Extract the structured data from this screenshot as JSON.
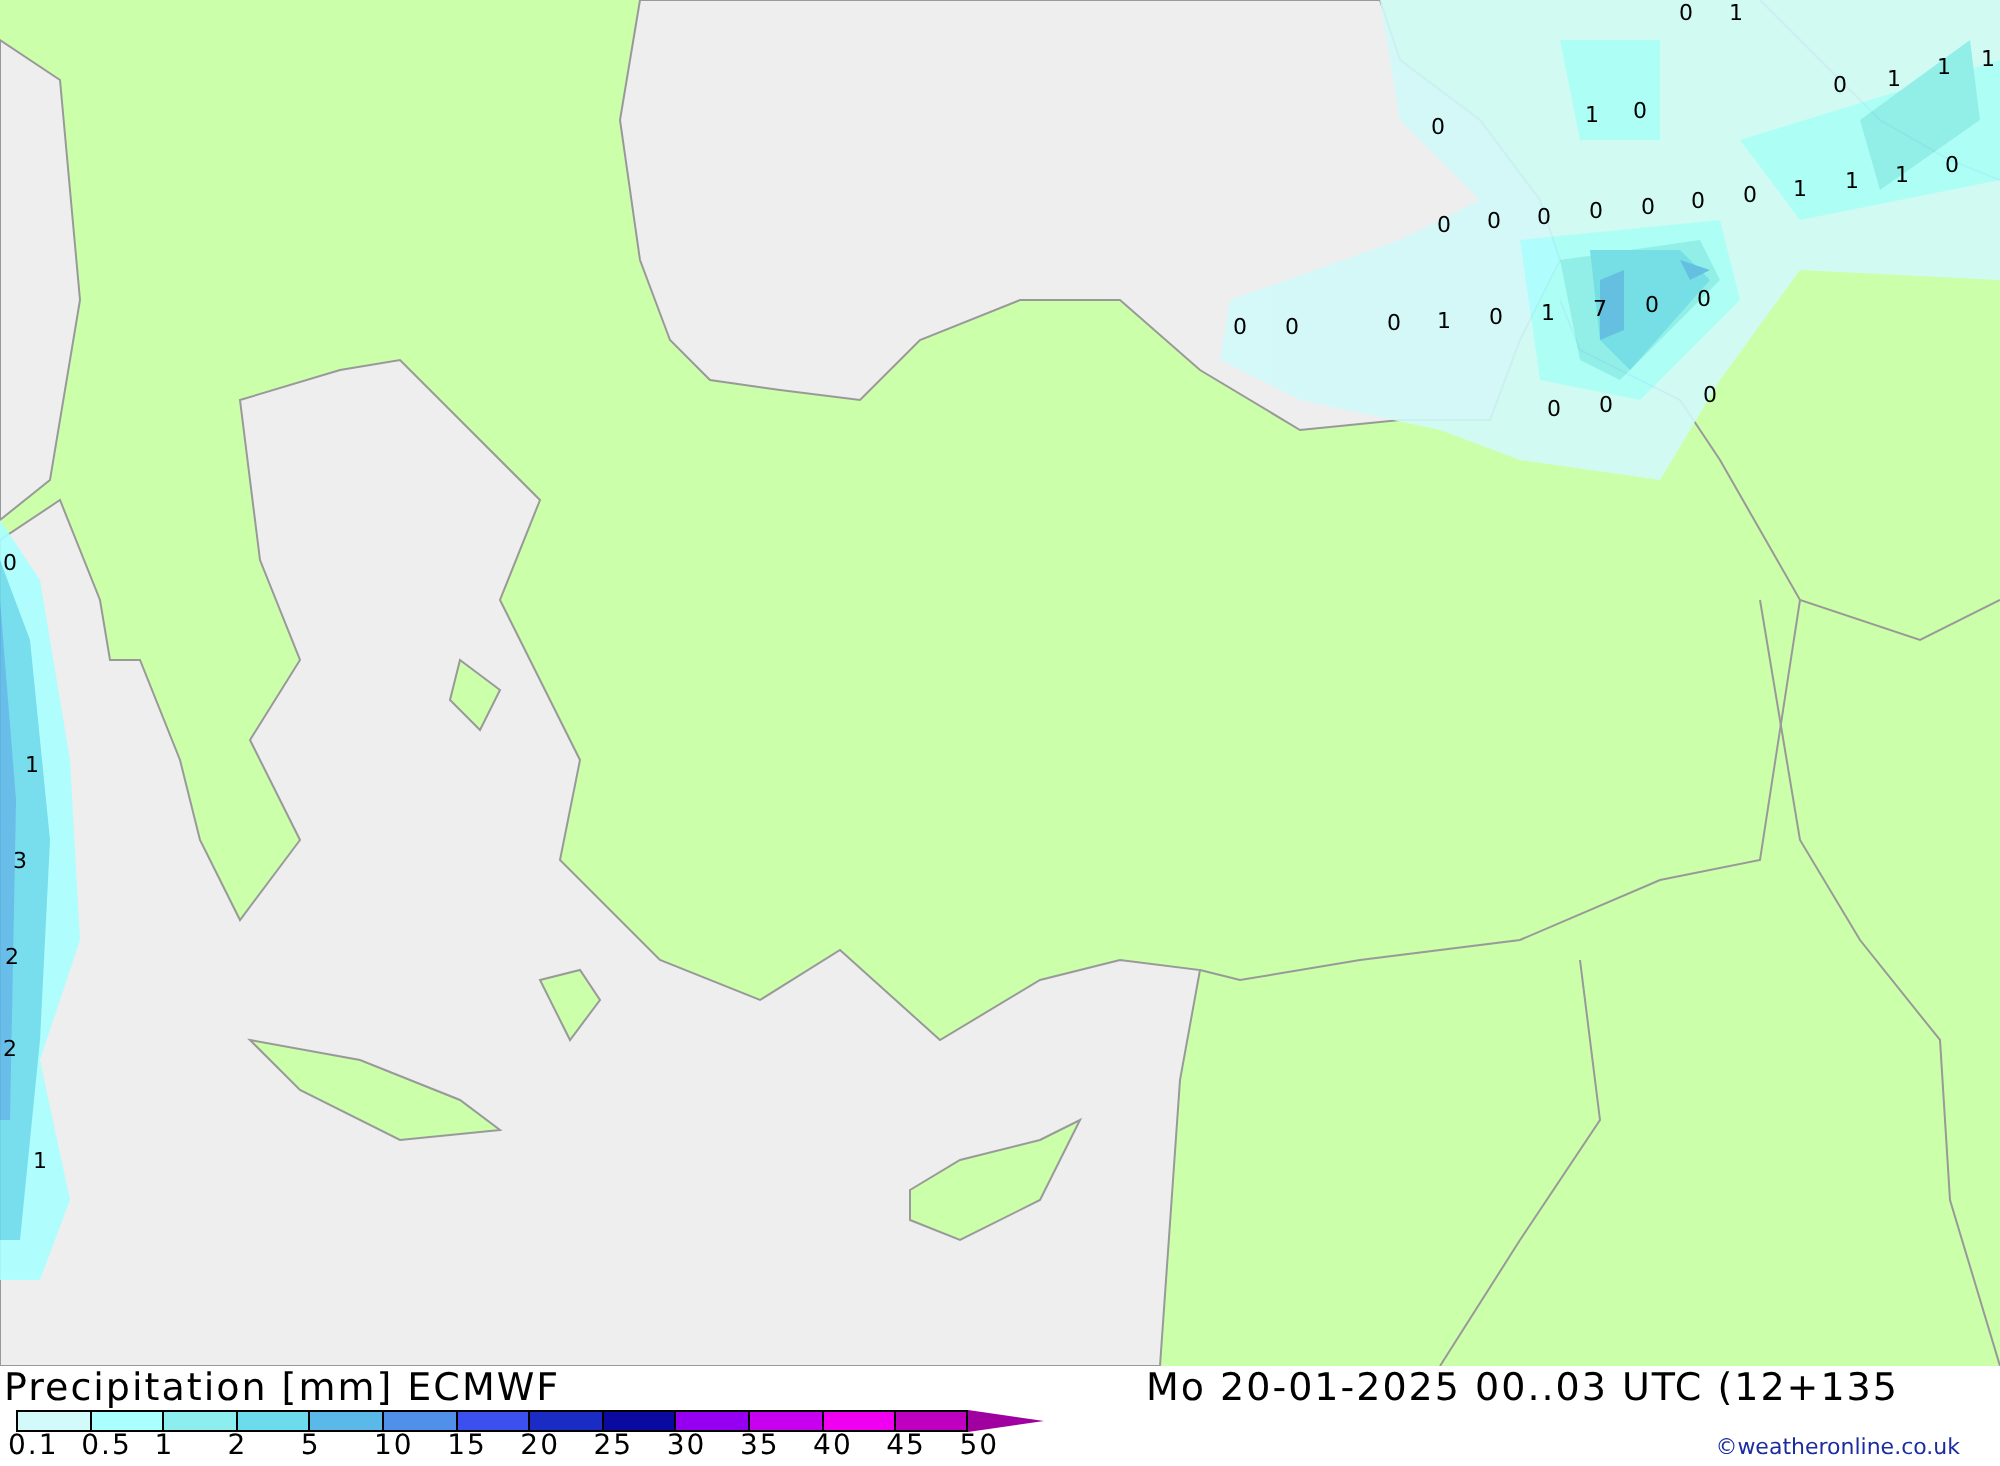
{
  "map": {
    "values": [
      "0",
      "1",
      "0",
      "1",
      "1",
      "1",
      "0",
      "1",
      "0",
      "0",
      "0",
      "0",
      "0",
      "0",
      "0",
      "0",
      "1",
      "1",
      "1",
      "0",
      "0",
      "0",
      "0",
      "1",
      "0",
      "1",
      "7",
      "0",
      "0",
      "0",
      "0",
      "0",
      "0",
      "1",
      "3",
      "2",
      "2",
      "1"
    ]
  },
  "title": "Precipitation [mm] ECMWF",
  "datetime": "Mo 20-01-2025 00..03 UTC (12+135",
  "legend": [
    {
      "label": "0.1",
      "color": "#d2fafa"
    },
    {
      "label": "0.5",
      "color": "#aaffff"
    },
    {
      "label": "1",
      "color": "#8ceeee"
    },
    {
      "label": "2",
      "color": "#6cdcec"
    },
    {
      "label": "5",
      "color": "#5ab9e8"
    },
    {
      "label": "10",
      "color": "#5090e8"
    },
    {
      "label": "15",
      "color": "#3c50f0"
    },
    {
      "label": "20",
      "color": "#1a2cc4"
    },
    {
      "label": "25",
      "color": "#0a0aa0"
    },
    {
      "label": "30",
      "color": "#9600f0"
    },
    {
      "label": "35",
      "color": "#c800f0"
    },
    {
      "label": "40",
      "color": "#f000f0"
    },
    {
      "label": "45",
      "color": "#c000c0"
    },
    {
      "label": "50",
      "color": "#a000a0"
    }
  ],
  "credit": "©weatheronline.co.uk"
}
